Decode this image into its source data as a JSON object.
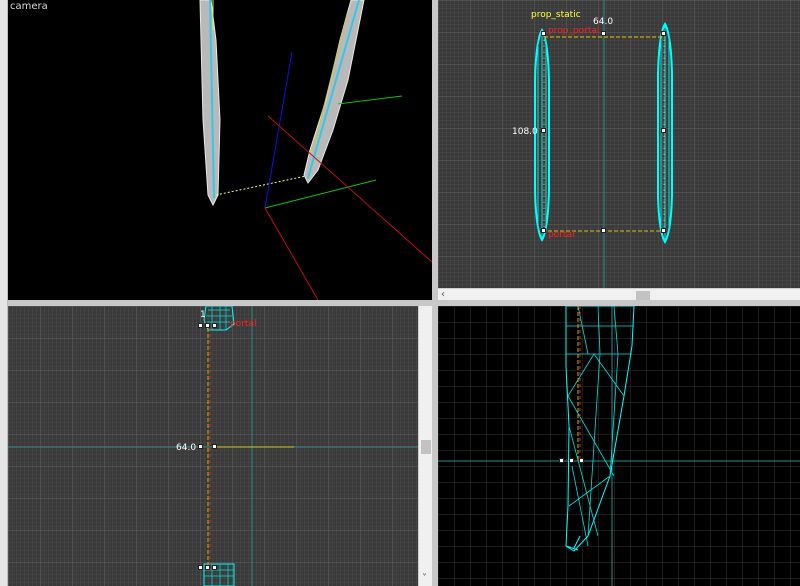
{
  "viewports": {
    "camera": {
      "label": "camera"
    },
    "top_right": {
      "entity_class": "prop_static",
      "entity_name": "prop_portal",
      "corner_label": "portal",
      "width_label": "64.0",
      "height_label": "108.0"
    },
    "bottom_left": {
      "top_label": "1       ",
      "top_name": "portal",
      "size_label": "64.0"
    },
    "bottom_right": {}
  },
  "colors": {
    "grid_background": "#3a3a3a",
    "wire": "#00ffff",
    "selection": "#ffff00",
    "entity_name": "#ff2020"
  },
  "icons": [
    "scroll-left-arrow-icon",
    "scroll-down-arrow-icon"
  ]
}
